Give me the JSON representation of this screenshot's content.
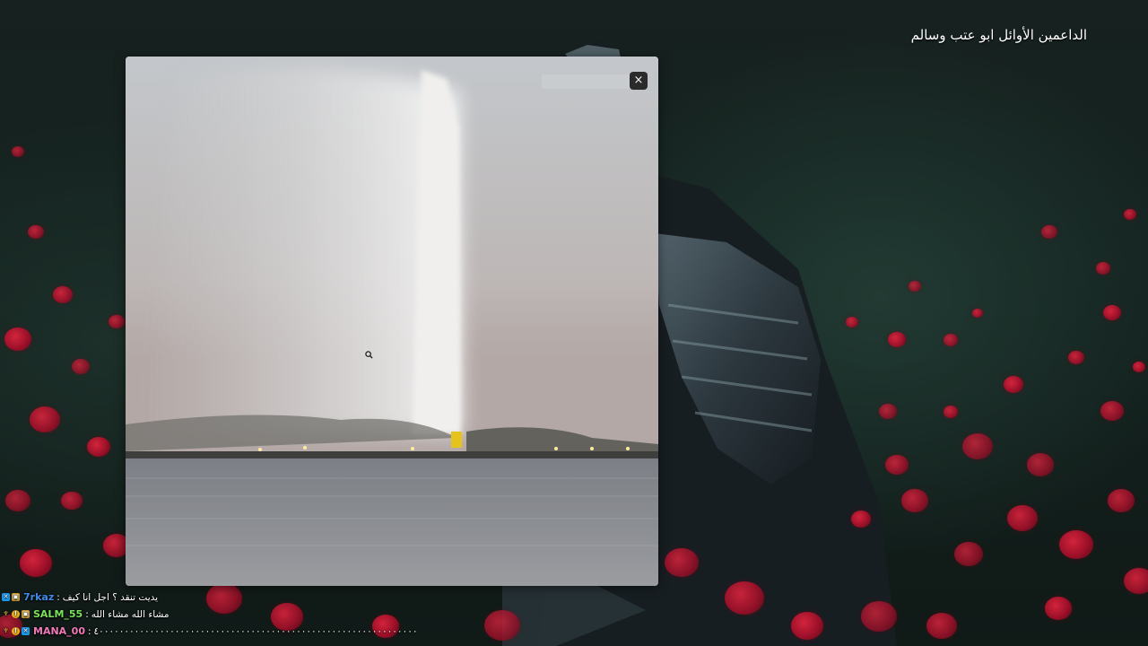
{
  "overlay": {
    "title": "الداعمين الأوائل ابو عتب وسالم"
  },
  "popup": {
    "search_placeholder": "",
    "close_label": "×"
  },
  "chat": {
    "messages": [
      {
        "badges": [
          "twitter-badge",
          "gift-badge"
        ],
        "badge_colors": [
          "#1d9bf0",
          "#e8b13a"
        ],
        "user": "7rkaz",
        "user_color": "#3f8be8",
        "text": "يديت تنقد ؟ اجل انا كيف"
      },
      {
        "badges": [
          "trophy-badge",
          "coin-badge",
          "gift-badge"
        ],
        "badge_colors": [
          "#d6b43c",
          "#f0b21a",
          "#e8b13a"
        ],
        "user": "SALM_55",
        "user_color": "#7be35a",
        "text": "مشاء الله مشاء الله"
      },
      {
        "badges": [
          "trophy-badge",
          "coin-badge",
          "twitter-badge"
        ],
        "badge_colors": [
          "#d6b43c",
          "#f0b21a",
          "#1d9bf0"
        ],
        "user": "MANA_00",
        "user_color": "#f07ab8",
        "text": "٤٠٠٠٠٠٠٠٠٠٠٠٠٠٠٠٠٠٠٠٠٠٠٠٠٠٠٠٠٠٠٠٠٠٠٠٠٠٠٠٠٠٠٠٠٠٠٠٠٠٠٠٠٠٠٠٠٠٠٠٠٠٠٠"
      }
    ]
  },
  "colors": {
    "accent_red": "#c8102e",
    "popup_close_bg": "#2a2a2a"
  }
}
